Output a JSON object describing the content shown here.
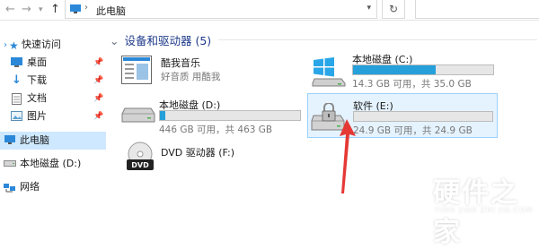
{
  "window": {
    "address": "此电脑"
  },
  "sidebar": {
    "items": [
      {
        "label": "快速访问",
        "icon": "star-icon"
      },
      {
        "label": "桌面",
        "icon": "desktop-icon",
        "pinned": true
      },
      {
        "label": "下载",
        "icon": "download-icon",
        "pinned": true
      },
      {
        "label": "文档",
        "icon": "document-icon",
        "pinned": true
      },
      {
        "label": "图片",
        "icon": "picture-icon",
        "pinned": true
      },
      {
        "label": "此电脑",
        "icon": "computer-icon",
        "selected": true
      },
      {
        "label": "本地磁盘 (D:)",
        "icon": "drive-icon"
      },
      {
        "label": "网络",
        "icon": "network-icon"
      }
    ]
  },
  "main": {
    "section_title": "设备和驱动器 (5)",
    "drives": [
      {
        "name": "酷我音乐",
        "sub": "好音质 用酷我"
      },
      {
        "name": "本地磁盘 (C:)",
        "sub": "14.3 GB 可用，共 35.0 GB",
        "used_fraction": 0.59
      },
      {
        "name": "本地磁盘 (D:)",
        "sub": "446 GB 可用，共 463 GB",
        "used_fraction": 0.04
      },
      {
        "name": "软件 (E:)",
        "sub": "24.9 GB 可用，共 24.9 GB",
        "used_fraction": 0.0,
        "selected": true
      },
      {
        "name": "DVD 驱动器 (F:)"
      }
    ]
  },
  "watermark": {
    "cn": "硬件之家",
    "en": "YING JIAN ZHI JIA.COM"
  },
  "colors": {
    "accent": "#26a0da",
    "selection": "#cde8ff",
    "arrow": "#e53935"
  }
}
